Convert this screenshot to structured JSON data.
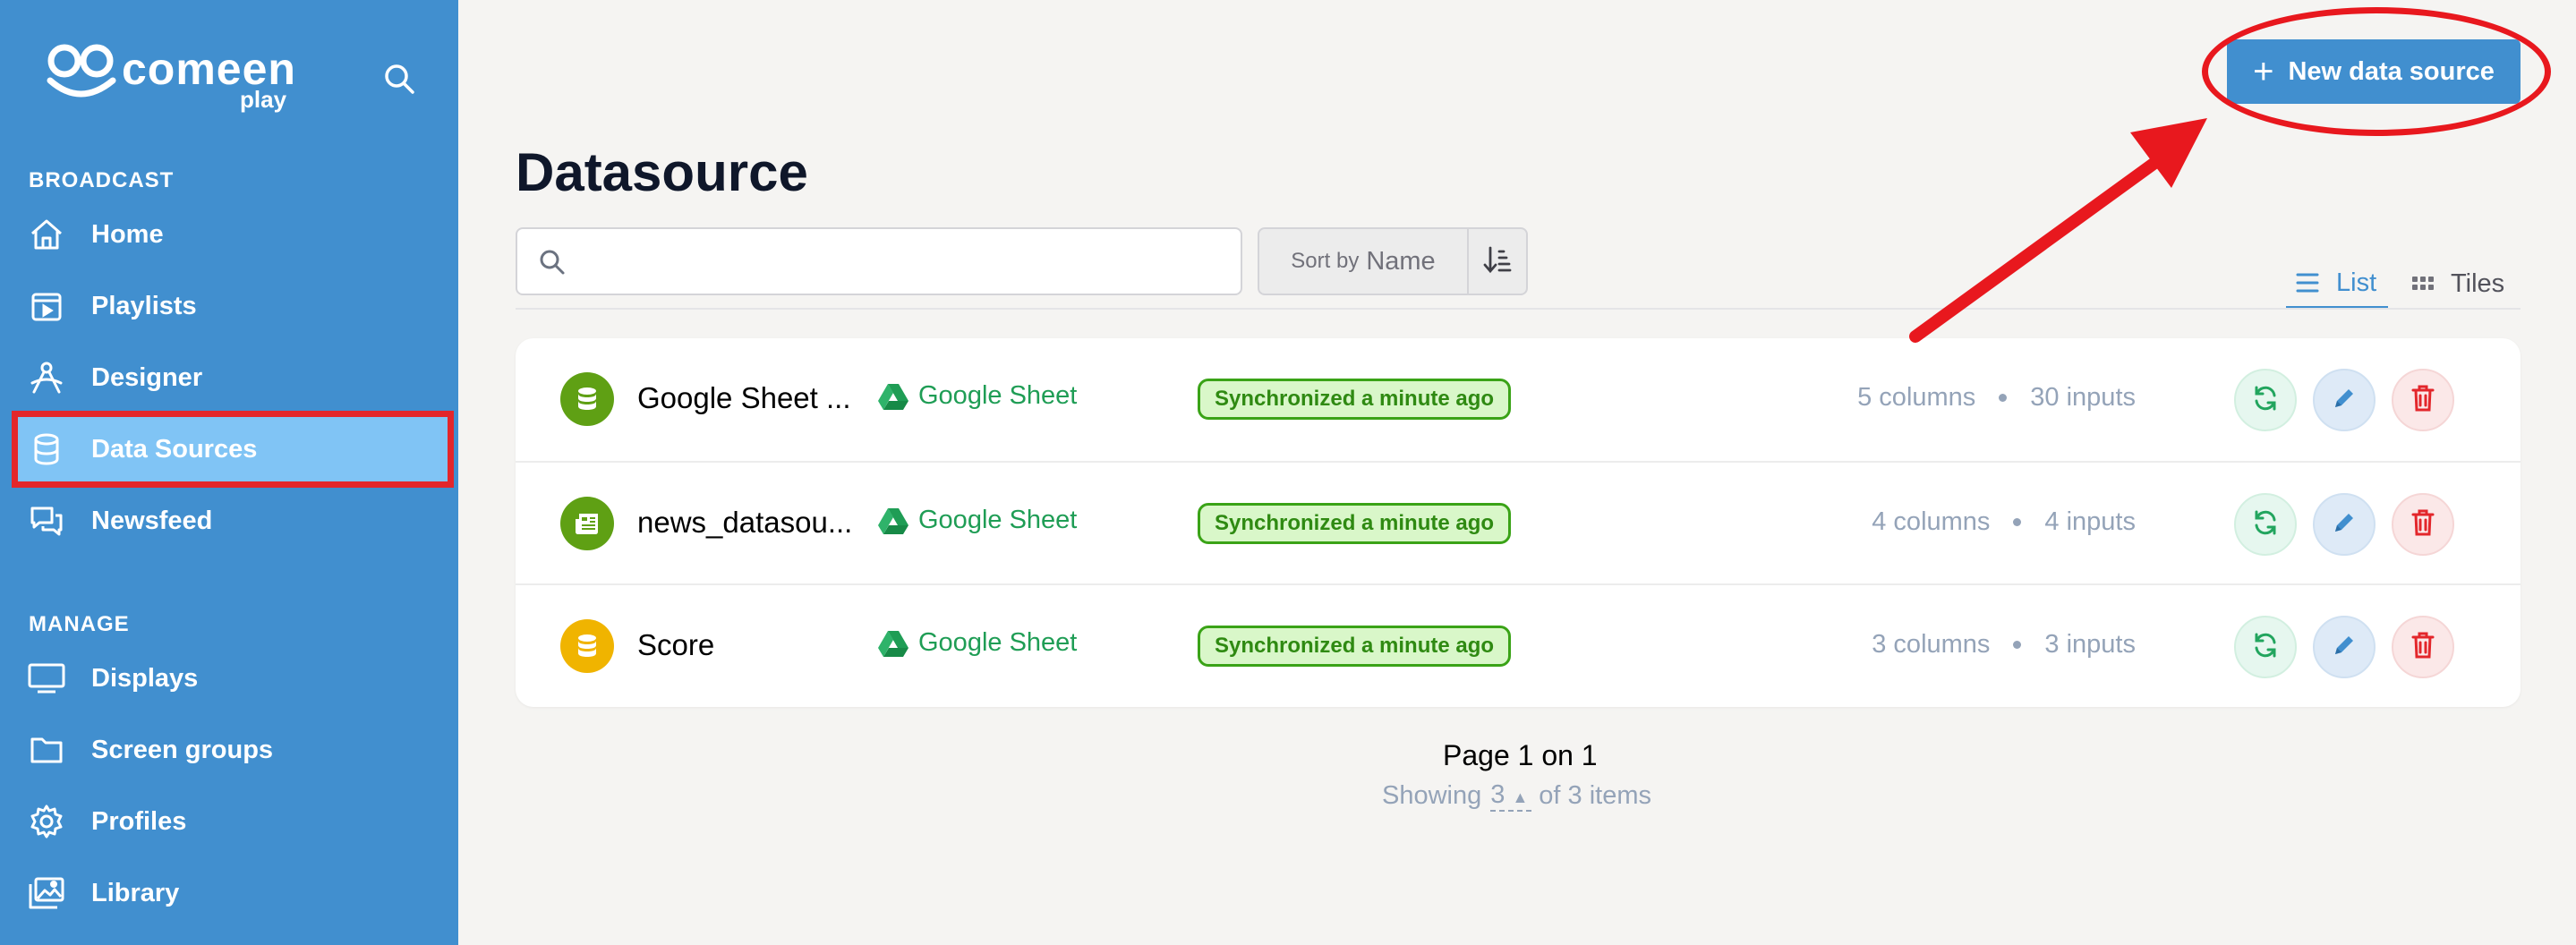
{
  "brand": {
    "name": "comeen",
    "sub": "play"
  },
  "sidebar": {
    "sections": [
      {
        "label": "BROADCAST"
      },
      {
        "label": "MANAGE"
      }
    ],
    "items": [
      {
        "label": "Home",
        "icon": "home-icon"
      },
      {
        "label": "Playlists",
        "icon": "playlist-icon"
      },
      {
        "label": "Designer",
        "icon": "designer-icon"
      },
      {
        "label": "Data Sources",
        "icon": "database-icon",
        "active": true
      },
      {
        "label": "Newsfeed",
        "icon": "chat-icon"
      },
      {
        "label": "Displays",
        "icon": "monitor-icon"
      },
      {
        "label": "Screen groups",
        "icon": "folder-icon"
      },
      {
        "label": "Profiles",
        "icon": "gear-icon"
      },
      {
        "label": "Library",
        "icon": "images-icon"
      }
    ]
  },
  "header": {
    "new_button": "New data source"
  },
  "page": {
    "title": "Datasource"
  },
  "toolbar": {
    "search_placeholder": "",
    "sort_prefix": "Sort by",
    "sort_value": "Name",
    "views": {
      "list": "List",
      "tiles": "Tiles"
    },
    "active_view": "List"
  },
  "rows": [
    {
      "name": "Google Sheet ...",
      "source": "Google Sheet",
      "status": "Synchronized a minute ago",
      "columns": "5 columns",
      "inputs": "30 inputs",
      "icon": "database-icon",
      "icon_color": "#5fa014"
    },
    {
      "name": "news_datasou...",
      "source": "Google Sheet",
      "status": "Synchronized a minute ago",
      "columns": "4 columns",
      "inputs": "4 inputs",
      "icon": "newspaper-icon",
      "icon_color": "#5fa014"
    },
    {
      "name": "Score",
      "source": "Google Sheet",
      "status": "Synchronized a minute ago",
      "columns": "3 columns",
      "inputs": "3 inputs",
      "icon": "database-icon",
      "icon_color": "#f0b400"
    }
  ],
  "pagination": {
    "title": "Page 1 on 1",
    "showing_prefix": "Showing",
    "per_page": "3",
    "showing_suffix": "of 3 items"
  },
  "colors": {
    "sidebar": "#418fcf",
    "accent": "#418fcf",
    "success": "#3aa317",
    "danger": "#e3262b",
    "annotation": "#e8181e"
  }
}
